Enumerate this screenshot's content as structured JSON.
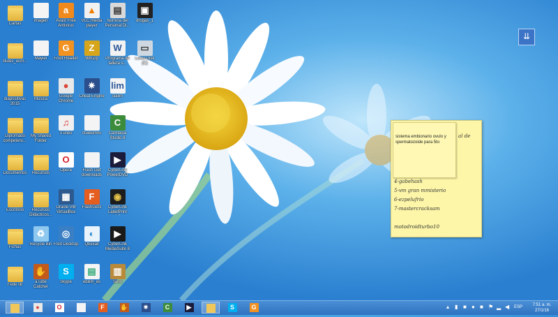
{
  "desktop_icons": [
    {
      "label": "Cartas",
      "icon": "folder-icon"
    },
    {
      "label": "imagen",
      "icon": "file-icon"
    },
    {
      "label": "Avast Free Antivirus",
      "icon": "avast-icon"
    },
    {
      "label": "VLC media player",
      "icon": "vlc-icon"
    },
    {
      "label": "Nomina del Personal Di...",
      "icon": "document-icon"
    },
    {
      "label": "drogas_1",
      "icon": "image-icon"
    },
    {
      "label": "clutes_ecm...",
      "icon": "folder-icon"
    },
    {
      "label": "Mayiel",
      "icon": "file-icon"
    },
    {
      "label": "Foxit Reader",
      "icon": "foxit-icon"
    },
    {
      "label": "WinZip",
      "icon": "winzip-icon"
    },
    {
      "label": "Programa de tallera s...",
      "icon": "word-icon"
    },
    {
      "label": "Local Disk (C)",
      "icon": "drive-icon"
    },
    {
      "label": "diapositivas 2015",
      "icon": "folder-icon"
    },
    {
      "label": "Música",
      "icon": "folder-icon"
    },
    {
      "label": "Google Chrome",
      "icon": "chrome-icon"
    },
    {
      "label": "Cheat Engine",
      "icon": "cheat-engine-icon"
    },
    {
      "label": "slalim",
      "icon": "lim-icon"
    },
    {
      "label": "Diplomado competenc...",
      "icon": "folder-icon"
    },
    {
      "label": "My Shared Folder",
      "icon": "folder-icon"
    },
    {
      "label": "iTunes",
      "icon": "itunes-icon"
    },
    {
      "label": "ctuelemns",
      "icon": "file-icon"
    },
    {
      "label": "Camtasia Studio 8",
      "icon": "camtasia-icon"
    },
    {
      "label": "Documentos",
      "icon": "folder-icon"
    },
    {
      "label": "Recursos",
      "icon": "folder-icon"
    },
    {
      "label": "Opera",
      "icon": "opera-icon"
    },
    {
      "label": "Flash Get downloads",
      "icon": "file-icon"
    },
    {
      "label": "CyberLink PowerDVD 10",
      "icon": "powerdvd-icon"
    },
    {
      "label": "Escritorio",
      "icon": "folder-icon"
    },
    {
      "label": "Recursos Didacticos...",
      "icon": "folder-icon"
    },
    {
      "label": "Oracle VM VirtualBox",
      "icon": "virtualbox-icon"
    },
    {
      "label": "FlashGet3",
      "icon": "flashget-icon"
    },
    {
      "label": "CyberLink LabelPrint 2.5",
      "icon": "labelprint-icon"
    },
    {
      "label": "Fichas",
      "icon": "folder-icon"
    },
    {
      "label": "Recycle Bin",
      "icon": "recycle-bin-icon"
    },
    {
      "label": "Fred Desktop",
      "icon": "desktop-icon"
    },
    {
      "label": "Qbexall",
      "icon": "qbexall-icon"
    },
    {
      "label": "CyberLink MediaSuite 8",
      "icon": "mediasuite-icon"
    },
    {
      "label": "Fede lib",
      "icon": "folder-icon"
    },
    {
      "label": "aTube Catcher",
      "icon": "atube-icon"
    },
    {
      "label": "Skype",
      "icon": "skype-icon"
    },
    {
      "label": "edilim_es",
      "icon": "edilim-icon"
    },
    {
      "label": "Sello",
      "icon": "winrar-icon"
    }
  ],
  "sticky_note": {
    "inner_note_text": "sistema embionario ovulo y spermatozoide para 5to",
    "side_text": "al de",
    "lines": [
      "4-gabehash",
      "5-vm gran mmisterio",
      "6-ezpelufrio",
      "7-mastercracksam",
      "",
      "motodroidturbo10"
    ]
  },
  "corner_button": {
    "icon": "download-arrows-icon"
  },
  "taskbar": {
    "items": [
      {
        "name": "file-explorer",
        "icon": "folder-icon",
        "active": true
      },
      {
        "name": "chrome",
        "icon": "chrome-icon",
        "active": false
      },
      {
        "name": "opera",
        "icon": "opera-icon",
        "active": false
      },
      {
        "name": "notepad",
        "icon": "file-icon",
        "active": false
      },
      {
        "name": "flashget",
        "icon": "flashget-icon",
        "active": false
      },
      {
        "name": "atube",
        "icon": "atube-icon",
        "active": false
      },
      {
        "name": "cheat-engine",
        "icon": "cheat-engine-icon",
        "active": false
      },
      {
        "name": "camtasia",
        "icon": "camtasia-icon",
        "active": false
      },
      {
        "name": "powerdvd",
        "icon": "powerdvd-icon",
        "active": false
      },
      {
        "name": "explorer",
        "icon": "folder-icon",
        "active": true
      },
      {
        "name": "skype",
        "icon": "skype-icon",
        "active": false
      },
      {
        "name": "foxit",
        "icon": "foxit-icon",
        "active": false
      }
    ],
    "language": "ESP",
    "time": "7:51 a. m.",
    "date": "27/1/16"
  },
  "colors": {
    "taskbar": "#2f72c0",
    "sticky": "#fdf6a8",
    "accent": "#3b74c6"
  }
}
